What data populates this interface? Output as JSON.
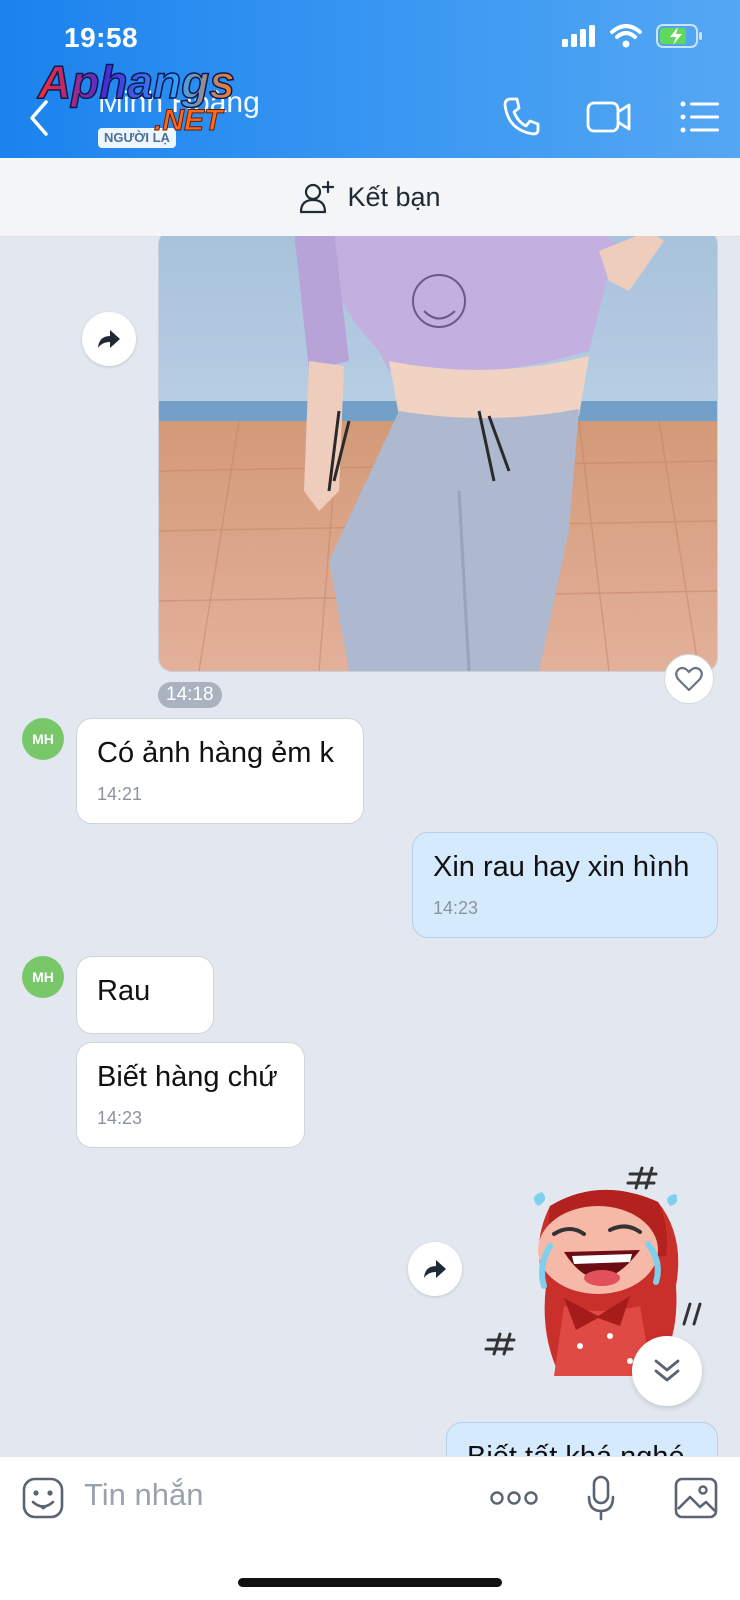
{
  "status": {
    "time": "19:58"
  },
  "header": {
    "contact_name": "Minh Hoàng",
    "badge": "NGƯỜI LẠ",
    "watermark_main": "Aphangs",
    "watermark_sub": ".NET"
  },
  "add_friend": {
    "label": "Kết bạn"
  },
  "messages": {
    "photo_time": "14:18",
    "m1": {
      "avatar": "MH",
      "text": "Có ảnh hàng ẻm k",
      "time": "14:21"
    },
    "m2": {
      "text": "Xin rau hay xin hình",
      "time": "14:23"
    },
    "m3": {
      "avatar": "MH",
      "text": "Rau"
    },
    "m4": {
      "text": "Biết hàng chứ",
      "time": "14:23"
    },
    "m5_partial": {
      "text": "Biết tất khá nghé"
    }
  },
  "composer": {
    "placeholder": "Tin nhắn"
  },
  "colors": {
    "header": "#1b82ee",
    "outgoing_bubble": "#d5eafd",
    "avatar": "#78c86a"
  }
}
